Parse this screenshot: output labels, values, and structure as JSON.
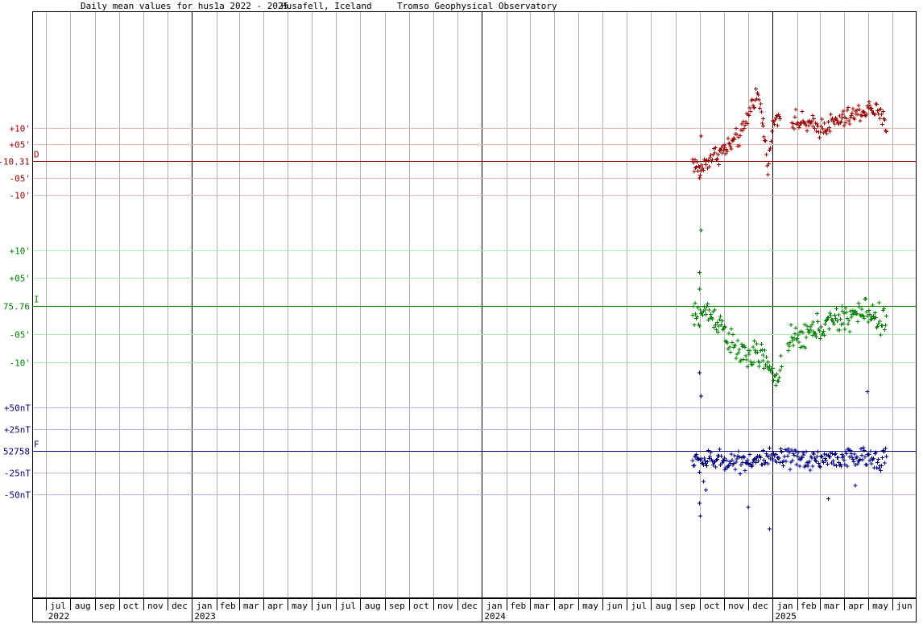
{
  "header": {
    "title": "Daily mean values for hus1a 2022 - 2025",
    "station": "Husafell, Iceland",
    "observatory": "Tromso Geophysical Observatory"
  },
  "colors": {
    "D": "#990000",
    "I": "#008000",
    "F": "#000080",
    "D_grid": "#f0b4b4",
    "I_grid": "#a8e8a8",
    "F_grid": "#b4b4ee",
    "month_grid": "#b0b0b0",
    "year_line": "#000000"
  },
  "chart_data": {
    "type": "scatter",
    "x_unit": "month",
    "x_range": [
      "2022-06-15",
      "2025-06-30"
    ],
    "month_labels": [
      "jul",
      "aug",
      "sep",
      "oct",
      "nov",
      "dec",
      "jan",
      "feb",
      "mar",
      "apr",
      "may",
      "jun",
      "jul",
      "aug",
      "sep",
      "oct",
      "nov",
      "dec",
      "jan",
      "feb",
      "mar",
      "apr",
      "may",
      "jun",
      "jul",
      "aug",
      "sep",
      "oct",
      "nov",
      "dec",
      "jan",
      "feb",
      "mar",
      "apr",
      "may",
      "jun"
    ],
    "year_labels": [
      "2022",
      "2023",
      "2024",
      "2025"
    ],
    "panels": [
      {
        "name": "D",
        "baseline_label": "-10.31",
        "unit": "arcmin",
        "offset_labels": [
          {
            "offset": 10,
            "text": "+10'"
          },
          {
            "offset": 5,
            "text": "+05'"
          },
          {
            "offset": -5,
            "text": "-05'"
          },
          {
            "offset": -10,
            "text": "-10'"
          }
        ],
        "ylim": [
          -20,
          45
        ],
        "segments": [
          {
            "start": "2024-09-22",
            "end": "2024-12-20",
            "kp": [
              [
                0,
                0
              ],
              [
                0.1,
                -3
              ],
              [
                0.25,
                1
              ],
              [
                0.5,
                4
              ],
              [
                0.7,
                8
              ],
              [
                0.85,
                18
              ],
              [
                0.92,
                20
              ],
              [
                1,
                12
              ]
            ],
            "amp": 3,
            "step": 1
          },
          {
            "start": "2024-12-20",
            "end": "2025-01-10",
            "kp": [
              [
                0,
                10
              ],
              [
                0.3,
                -2
              ],
              [
                0.6,
                12
              ],
              [
                1,
                14
              ]
            ],
            "amp": 2,
            "step": 1
          },
          {
            "start": "2025-01-25",
            "end": "2025-05-24",
            "kp": [
              [
                0,
                12
              ],
              [
                0.3,
                10
              ],
              [
                0.6,
                13
              ],
              [
                0.85,
                16
              ],
              [
                1,
                11
              ]
            ],
            "amp": 3,
            "step": 1
          }
        ],
        "extras": [
          [
            "2024-10-03",
            7.5
          ],
          [
            "2024-10-01",
            -5
          ]
        ]
      },
      {
        "name": "I",
        "baseline_label": "75.76",
        "unit": "arcmin",
        "offset_labels": [
          {
            "offset": 10,
            "text": "+10'"
          },
          {
            "offset": 5,
            "text": "+05'"
          },
          {
            "offset": -5,
            "text": "-05'"
          },
          {
            "offset": -10,
            "text": "-10'"
          }
        ],
        "ylim": [
          -28,
          50
        ],
        "segments": [
          {
            "start": "2024-09-22",
            "end": "2024-12-20",
            "kp": [
              [
                0,
                -2
              ],
              [
                0.2,
                -1
              ],
              [
                0.4,
                -3
              ],
              [
                0.6,
                -8
              ],
              [
                0.8,
                -9
              ],
              [
                1,
                -9
              ]
            ],
            "amp": 2.5,
            "step": 1
          },
          {
            "start": "2024-12-20",
            "end": "2025-01-12",
            "kp": [
              [
                0,
                -9
              ],
              [
                0.4,
                -12
              ],
              [
                0.7,
                -13
              ],
              [
                1,
                -10
              ]
            ],
            "amp": 2,
            "step": 1
          },
          {
            "start": "2025-01-20",
            "end": "2025-05-24",
            "kp": [
              [
                0,
                -7
              ],
              [
                0.3,
                -4
              ],
              [
                0.6,
                -2
              ],
              [
                0.8,
                -1
              ],
              [
                1,
                -3
              ]
            ],
            "amp": 2.5,
            "step": 1
          }
        ],
        "extras": [
          [
            "2024-10-03",
            13.5
          ],
          [
            "2024-10-01",
            6
          ],
          [
            "2024-10-01",
            3
          ]
        ]
      },
      {
        "name": "F",
        "baseline_label": "52758",
        "unit": "nT",
        "offset_labels": [
          {
            "offset": 50,
            "text": "+50nT"
          },
          {
            "offset": 25,
            "text": "+25nT"
          },
          {
            "offset": -25,
            "text": "-25nT"
          },
          {
            "offset": -50,
            "text": "-50nT"
          }
        ],
        "ylim": [
          -180,
          330
        ],
        "segments": [
          {
            "start": "2024-09-22",
            "end": "2025-05-24",
            "kp": [
              [
                0,
                -12
              ],
              [
                0.5,
                -10
              ],
              [
                1,
                -8
              ]
            ],
            "amp": 12,
            "step": 1
          }
        ],
        "extras": [
          [
            "2024-10-01",
            -60
          ],
          [
            "2024-10-02",
            -75
          ],
          [
            "2024-10-06",
            -35
          ],
          [
            "2024-10-09",
            -45
          ],
          [
            "2024-10-01",
            90
          ],
          [
            "2024-10-03",
            63
          ],
          [
            "2024-12-01",
            -65
          ],
          [
            "2024-12-28",
            -90
          ],
          [
            "2025-04-30",
            68
          ],
          [
            "2025-03-12",
            -55
          ],
          [
            "2025-04-15",
            -40
          ]
        ]
      }
    ]
  }
}
